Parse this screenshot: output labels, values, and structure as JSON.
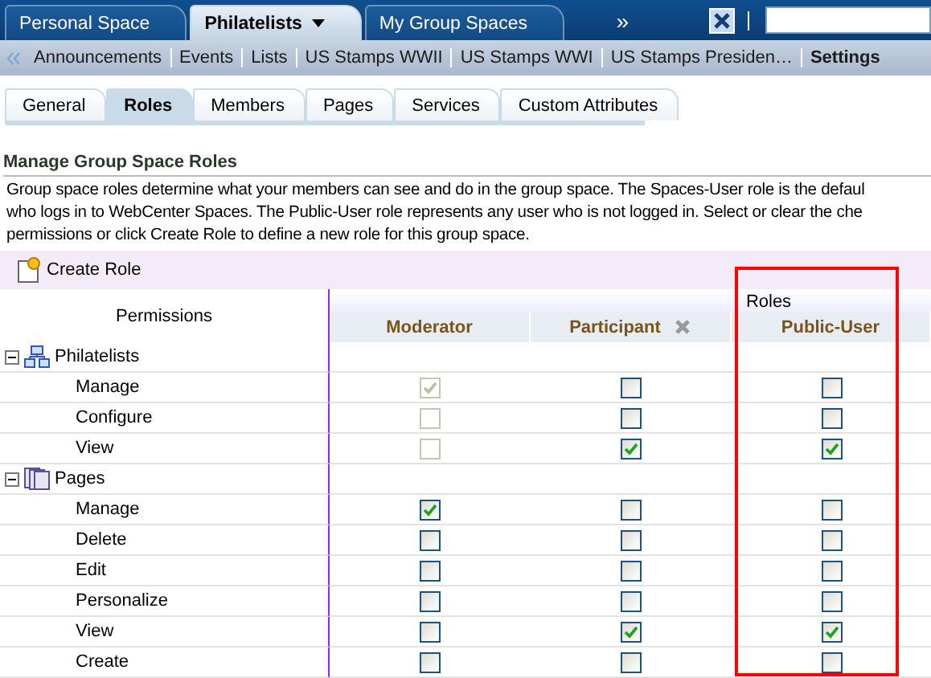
{
  "space_tabs": [
    {
      "label": "Personal Space",
      "selected": false,
      "menu": false
    },
    {
      "label": "Philatelists",
      "selected": true,
      "menu": true
    },
    {
      "label": "My Group Spaces",
      "selected": false,
      "menu": false
    }
  ],
  "more_glyph": "»",
  "page_links": [
    {
      "label": "Announcements",
      "selected": false
    },
    {
      "label": "Events",
      "selected": false
    },
    {
      "label": "Lists",
      "selected": false
    },
    {
      "label": "US Stamps WWII",
      "selected": false
    },
    {
      "label": "US Stamps WWI",
      "selected": false
    },
    {
      "label": "US Stamps Presiden…",
      "selected": false
    },
    {
      "label": "Settings",
      "selected": true
    }
  ],
  "settings_tabs": [
    {
      "label": "General",
      "selected": false
    },
    {
      "label": "Roles",
      "selected": true
    },
    {
      "label": "Members",
      "selected": false
    },
    {
      "label": "Pages",
      "selected": false
    },
    {
      "label": "Services",
      "selected": false
    },
    {
      "label": "Custom Attributes",
      "selected": false
    }
  ],
  "heading": "Manage Group Space Roles",
  "description": [
    "Group space roles determine what your members can see and do in the group space. The Spaces-User role is the defaul",
    "who logs in to WebCenter Spaces. The Public-User role represents any user who is not logged in. Select or clear the che",
    "permissions or click Create Role to define a new role for this group space."
  ],
  "create_role": "Create Role",
  "table": {
    "permissions_header": "Permissions",
    "roles_header": "Roles",
    "roles": [
      {
        "name": "Moderator",
        "removable": false,
        "highlighted": false
      },
      {
        "name": "Participant",
        "removable": true,
        "highlighted": false
      },
      {
        "name": "Public-User",
        "removable": false,
        "highlighted": true
      }
    ],
    "groups": [
      {
        "name": "Philatelists",
        "kind": "group",
        "expanded": true,
        "permissions": [
          {
            "name": "Manage",
            "checks": [
              {
                "checked": true,
                "disabled": true
              },
              {
                "checked": false,
                "disabled": false
              },
              {
                "checked": false,
                "disabled": false
              }
            ]
          },
          {
            "name": "Configure",
            "checks": [
              {
                "checked": false,
                "disabled": true
              },
              {
                "checked": false,
                "disabled": false
              },
              {
                "checked": false,
                "disabled": false
              }
            ]
          },
          {
            "name": "View",
            "checks": [
              {
                "checked": false,
                "disabled": true
              },
              {
                "checked": true,
                "disabled": false
              },
              {
                "checked": true,
                "disabled": false
              }
            ]
          }
        ]
      },
      {
        "name": "Pages",
        "kind": "pages",
        "expanded": true,
        "permissions": [
          {
            "name": "Manage",
            "checks": [
              {
                "checked": true,
                "disabled": false
              },
              {
                "checked": false,
                "disabled": false
              },
              {
                "checked": false,
                "disabled": false
              }
            ]
          },
          {
            "name": "Delete",
            "checks": [
              {
                "checked": false,
                "disabled": false
              },
              {
                "checked": false,
                "disabled": false
              },
              {
                "checked": false,
                "disabled": false
              }
            ]
          },
          {
            "name": "Edit",
            "checks": [
              {
                "checked": false,
                "disabled": false
              },
              {
                "checked": false,
                "disabled": false
              },
              {
                "checked": false,
                "disabled": false
              }
            ]
          },
          {
            "name": "Personalize",
            "checks": [
              {
                "checked": false,
                "disabled": false
              },
              {
                "checked": false,
                "disabled": false
              },
              {
                "checked": false,
                "disabled": false
              }
            ]
          },
          {
            "name": "View",
            "checks": [
              {
                "checked": false,
                "disabled": false
              },
              {
                "checked": true,
                "disabled": false
              },
              {
                "checked": true,
                "disabled": false
              }
            ]
          },
          {
            "name": "Create",
            "checks": [
              {
                "checked": false,
                "disabled": false
              },
              {
                "checked": false,
                "disabled": false
              },
              {
                "checked": false,
                "disabled": false
              }
            ]
          }
        ]
      }
    ]
  }
}
